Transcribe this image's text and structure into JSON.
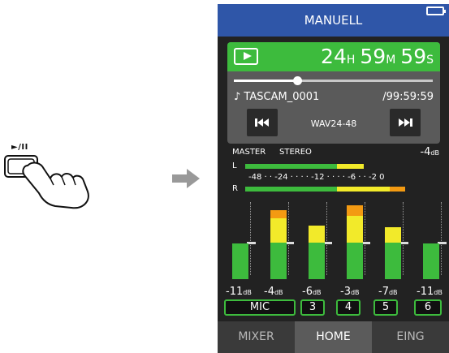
{
  "illustration": {
    "button_caption": "►/II",
    "hand_icon": "pressing-hand-icon",
    "arrow_icon": "right-arrow-icon"
  },
  "screen": {
    "title": "MANUELL",
    "battery_icon": "battery-icon",
    "transport": {
      "play_icon": "play-icon",
      "time": {
        "hours": "24",
        "h_unit": "H",
        "minutes": "59",
        "m_unit": "M",
        "seconds": "59",
        "s_unit": "S"
      },
      "progress": 0.32,
      "filename": "♪ TASCAM_0001",
      "remaining": "/99:59:59",
      "format": "WAV24-48",
      "prev_icon": "skip-back-icon",
      "next_icon": "skip-forward-icon"
    },
    "master": {
      "label": "MASTER",
      "mode": "STEREO",
      "level_value": "-4",
      "level_unit": "dB",
      "left_label": "L",
      "right_label": "R",
      "scale": "-48 · · -24 · · · · -12 · · · · -6 · · -2 0",
      "left_levels": {
        "green": 0.47,
        "yellow": 0.14
      },
      "right_levels": {
        "green": 0.47,
        "yellow": 0.27,
        "orange": 0.08
      }
    },
    "channels": [
      {
        "level_value": "-11",
        "level_unit": "dB",
        "meter": {
          "green": 0.46
        },
        "fader": 0.48,
        "button": "MIC"
      },
      {
        "level_value": "-4",
        "level_unit": "dB",
        "meter": {
          "green": 0.47,
          "yellow": 0.32,
          "orange": 0.11
        },
        "fader": 0.48,
        "button": ""
      },
      {
        "level_value": "-6",
        "level_unit": "dB",
        "meter": {
          "green": 0.47,
          "yellow": 0.23
        },
        "fader": 0.48,
        "button": "3"
      },
      {
        "level_value": "-3",
        "level_unit": "dB",
        "meter": {
          "green": 0.47,
          "yellow": 0.35,
          "orange": 0.14
        },
        "fader": 0.48,
        "button": "4"
      },
      {
        "level_value": "-7",
        "level_unit": "dB",
        "meter": {
          "green": 0.47,
          "yellow": 0.2
        },
        "fader": 0.48,
        "button": "5"
      },
      {
        "level_value": "-11",
        "level_unit": "dB",
        "meter": {
          "green": 0.46
        },
        "fader": 0.48,
        "button": "6"
      }
    ],
    "tabs": [
      {
        "label": "MIXER",
        "active": false
      },
      {
        "label": "HOME",
        "active": true
      },
      {
        "label": "EING",
        "active": false
      }
    ]
  },
  "colors": {
    "title_bar": "#2f56a8",
    "accent_green": "#3dbb3d",
    "meter_yellow": "#f2ea2a",
    "meter_orange": "#f39a12",
    "background": "#222222"
  }
}
